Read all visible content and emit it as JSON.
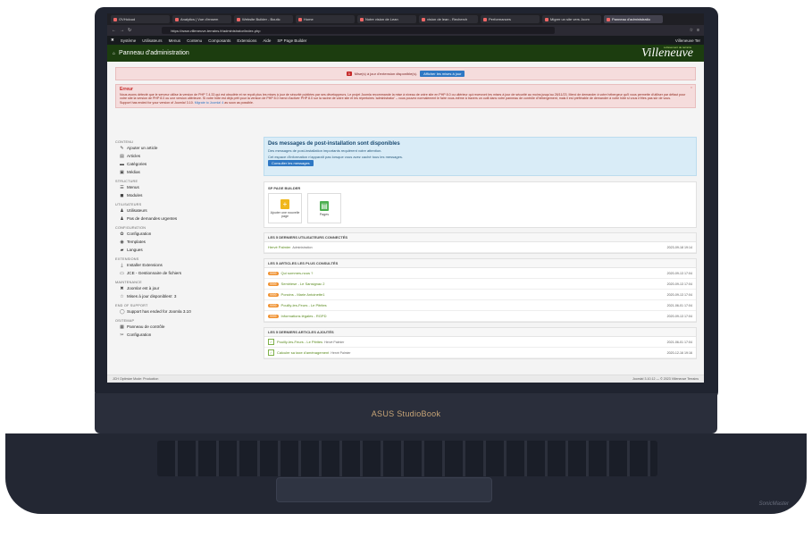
{
  "browser": {
    "tabs": [
      {
        "label": "OVHcloud",
        "active": false
      },
      {
        "label": "Analytics | Vue d'ensem",
        "active": false
      },
      {
        "label": "Website Builder - Boutic",
        "active": false
      },
      {
        "label": "Home",
        "active": false
      },
      {
        "label": "Notre vision de Lean",
        "active": false
      },
      {
        "label": "vision de lean - Recherch",
        "active": false
      },
      {
        "label": "Performances",
        "active": false
      },
      {
        "label": "Migrer un site vers Joom",
        "active": false
      },
      {
        "label": "Panneau d'administratio",
        "active": true
      }
    ],
    "url": "https://www.villeneuve-terrains.fr/administrator/index.php"
  },
  "joomla_menu": {
    "items": [
      "Système",
      "Utilisateurs",
      "Menus",
      "Contenu",
      "Composants",
      "Extensions",
      "Aide",
      "SP Page Builder"
    ],
    "user": "Villeneuve Ter"
  },
  "header": {
    "title": "Panneau d'administration",
    "brand": "Villeneuve",
    "brand_sub": "Lotissement de terrains"
  },
  "update_notice": {
    "count": "3",
    "text": "Mise(s) à jour d'extension disponible(s).",
    "button": "Afficher les mises à jour"
  },
  "error": {
    "title": "Erreur",
    "message": "Nous avons détecté que le serveur utilise la version de PHP 7.4.33 qui est obsolète et ne reçoit plus les mises à jour de sécurité publiées par ses développeurs. Le projet Joomla recommande la mise à niveau de votre site en PHP 8.0 ou ultérieur qui recevront les mises à jour de sécurité au moins jusqu'au 26/11/23. Merci de demander à votre hébergeur qu'il vous permette d'utiliser par défaut pour votre site la version de PHP 8.0 ou une version ultérieure. Si votre hôte est déjà prêt pour la version de PHP 8.0 merci d'activer PHP 8.0 sur la racine de votre site et les répertoires 'administrator' – vous pouvez normalement le faire vous-même à travers un outil dans votre panneau de contrôle d'hébergement, mais il est préférable de demander à votre hôte si vous n'êtes pas sûr de vous.",
    "support_text": "Support has ended for your version of Joomla! 3.10.",
    "link": "Migrate to Joomla! 4",
    "link_tail": "as soon as possible."
  },
  "sidebar": {
    "sections": [
      {
        "title": "CONTENU",
        "items": [
          {
            "icon": "pencil-icon",
            "glyph": "✎",
            "label": "Ajouter un article"
          },
          {
            "icon": "stack-icon",
            "glyph": "▤",
            "label": "Articles"
          },
          {
            "icon": "folder-icon",
            "glyph": "▬",
            "label": "Catégories"
          },
          {
            "icon": "image-icon",
            "glyph": "▣",
            "label": "Médias"
          }
        ]
      },
      {
        "title": "STRUCTURE",
        "items": [
          {
            "icon": "list-icon",
            "glyph": "☰",
            "label": "Menus"
          },
          {
            "icon": "cube-icon",
            "glyph": "◼",
            "label": "Modules"
          }
        ]
      },
      {
        "title": "UTILISATEURS",
        "items": [
          {
            "icon": "users-icon",
            "glyph": "♟",
            "label": "Utilisateurs"
          },
          {
            "icon": "users-icon",
            "glyph": "♟",
            "label": "Pas de demandes urgentes"
          }
        ]
      },
      {
        "title": "CONFIGURATION",
        "items": [
          {
            "icon": "gear-icon",
            "glyph": "✿",
            "label": "Configuration"
          },
          {
            "icon": "eye-icon",
            "glyph": "◉",
            "label": "Templates"
          },
          {
            "icon": "comment-icon",
            "glyph": "▰",
            "label": "Langues"
          }
        ]
      },
      {
        "title": "EXTENSIONS",
        "items": [
          {
            "icon": "upload-icon",
            "glyph": "⤓",
            "label": "Installer Extensions"
          },
          {
            "icon": "jce-icon",
            "glyph": "▭",
            "label": "JCE - Gestionnaire de fichiers"
          }
        ]
      },
      {
        "title": "MAINTENANCE",
        "items": [
          {
            "icon": "joomla-icon",
            "glyph": "✖",
            "label": "Joomla! est à jour"
          },
          {
            "icon": "star-icon",
            "glyph": "☆",
            "label": "Mises à jour disponibles!: 3"
          }
        ]
      },
      {
        "title": "END OF SUPPORT",
        "items": [
          {
            "icon": "info-icon",
            "glyph": "◯",
            "label": "Support has ended for Joomla 3.10"
          }
        ]
      },
      {
        "title": "OSITEMAP",
        "items": [
          {
            "icon": "control-panel-icon",
            "glyph": "▦",
            "label": "Panneau de contrôle"
          },
          {
            "icon": "wrench-icon",
            "glyph": "✂",
            "label": "Configuration"
          }
        ]
      }
    ]
  },
  "postinstall": {
    "title": "Des messages de post-installation sont disponibles",
    "line1": "Des messages de post-installation importants requièrent votre attention.",
    "line2": "Cet espace d'information n'apparaît pas lorsque vous avez caché tous les messages.",
    "button": "Consulter les messages"
  },
  "sppb": {
    "title": "SP PAGE BUILDER",
    "tiles": [
      {
        "label": "Ajouter une nouvelle page",
        "glyph": "+",
        "color": "#f0b71b"
      },
      {
        "label": "Pages",
        "glyph": "▤",
        "color": "#4caf50"
      }
    ]
  },
  "logged_users": {
    "title": "LES 5 DERNIERS UTILISATEURS CONNECTÉS",
    "rows": [
      {
        "name": "Hervé Palmier",
        "extra": "Administration",
        "date": "2023-09-18 19:14"
      }
    ]
  },
  "popular": {
    "title": "LES 5 ARTICLES LES PLUS CONSULTÉS",
    "rows": [
      {
        "hits": "9999",
        "label": "Qui sommes-nous ?",
        "date": "2020-09-13 17:04"
      },
      {
        "hits": "9999",
        "label": "Semiriese - Le Sansignac 2",
        "date": "2020-09-13 17:04"
      },
      {
        "hits": "9999",
        "label": "Poncins - Marie Antoinette1",
        "date": "2020-09-13 17:04"
      },
      {
        "hits": "9999",
        "label": "Pouilly-les-Feurs - Le Pitrites",
        "date": "2021-06-01 17:04"
      },
      {
        "hits": "9999",
        "label": "Informations légales - RGPD",
        "date": "2020-09-13 17:04"
      }
    ]
  },
  "latest": {
    "title": "LES 5 DERNIERS ARTICLES AJOUTÉS",
    "rows": [
      {
        "label": "Pouilly-les-Feurs - Le Pitrites",
        "extra": "Hervé Palmier",
        "date": "2021-06-01 17:04"
      },
      {
        "label": "Calculer sa taxe d'aménagement",
        "extra": "Hervé Palmier",
        "date": "2020-12-16 19:16"
      }
    ]
  },
  "status": {
    "left": "JCH Optimize Mode: Production",
    "right": "Joomla! 3.10.12 — © 2023 Villeneuve Terrains"
  },
  "laptop": {
    "brand": "ASUS StudioBook",
    "sonic": "SonicMaster"
  }
}
